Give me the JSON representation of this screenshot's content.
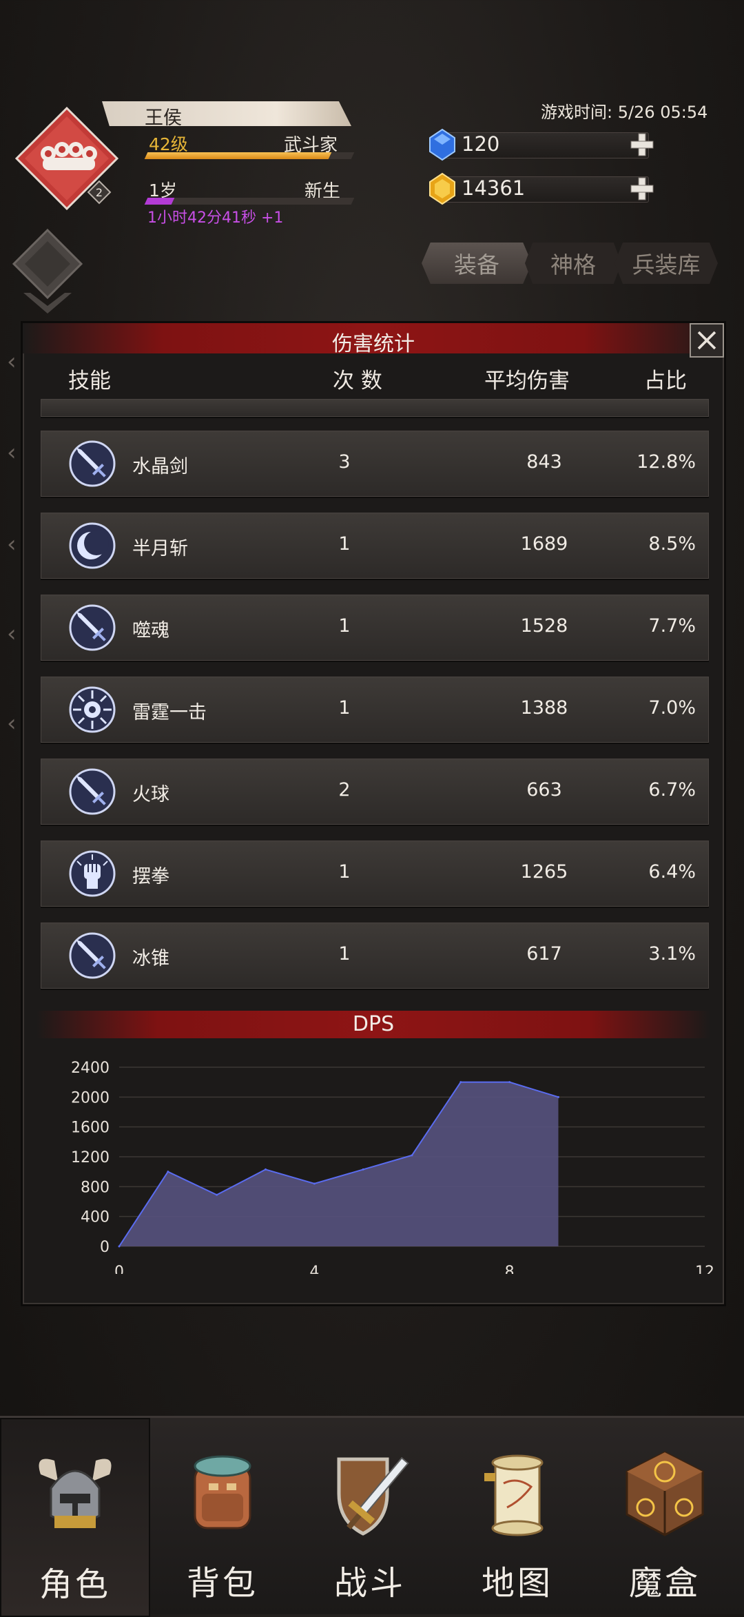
{
  "player": {
    "name": "王侯",
    "level": "42级",
    "class": "武斗家",
    "rank": "2",
    "age": "1岁",
    "status": "新生",
    "timer": "1小时42分41秒  +1",
    "level_progress": 0.89,
    "age_progress": 0.13
  },
  "game_time": "游戏时间: 5/26 05:54",
  "currency": {
    "gems": "120",
    "gold": "14361"
  },
  "tabs": [
    "装备",
    "神格",
    "兵装库"
  ],
  "modal": {
    "title": "伤害统计",
    "columns": {
      "skill": "技能",
      "count": "次 数",
      "avg": "平均伤害",
      "pct": "占比"
    },
    "rows": [
      {
        "icon": "sword-icon",
        "name": "水晶剑",
        "count": "3",
        "avg": "843",
        "pct": "12.8%"
      },
      {
        "icon": "crescent-icon",
        "name": "半月斩",
        "count": "1",
        "avg": "1689",
        "pct": "8.5%"
      },
      {
        "icon": "sword-icon",
        "name": "噬魂",
        "count": "1",
        "avg": "1528",
        "pct": "7.7%"
      },
      {
        "icon": "thunder-orb-icon",
        "name": "雷霆一击",
        "count": "1",
        "avg": "1388",
        "pct": "7.0%"
      },
      {
        "icon": "sword-icon",
        "name": "火球",
        "count": "2",
        "avg": "663",
        "pct": "6.7%"
      },
      {
        "icon": "fist-icon",
        "name": "摆拳",
        "count": "1",
        "avg": "1265",
        "pct": "6.4%"
      },
      {
        "icon": "sword-icon",
        "name": "冰锥",
        "count": "1",
        "avg": "617",
        "pct": "3.1%"
      }
    ],
    "dps_title": "DPS"
  },
  "chart_data": {
    "type": "area",
    "title": "DPS",
    "x": [
      0,
      1,
      2,
      3,
      4,
      5,
      6,
      7,
      8,
      9
    ],
    "values": [
      0,
      1000,
      690,
      1030,
      840,
      1030,
      1220,
      2200,
      2200,
      2000
    ],
    "xlim": [
      0,
      12
    ],
    "ylim": [
      0,
      2400
    ],
    "xticks": [
      0,
      4,
      8,
      12
    ],
    "yticks": [
      0,
      400,
      800,
      1200,
      1600,
      2000,
      2400
    ],
    "grid": true,
    "fill_color": "#56527e",
    "line_color": "#5a6cf0"
  },
  "nav": [
    {
      "label": "角色",
      "icon": "horned-helmet-icon",
      "active": true
    },
    {
      "label": "背包",
      "icon": "backpack-icon",
      "active": false
    },
    {
      "label": "战斗",
      "icon": "sword-shield-icon",
      "active": false
    },
    {
      "label": "地图",
      "icon": "scroll-map-icon",
      "active": false
    },
    {
      "label": "魔盒",
      "icon": "magic-box-icon",
      "active": false
    }
  ]
}
